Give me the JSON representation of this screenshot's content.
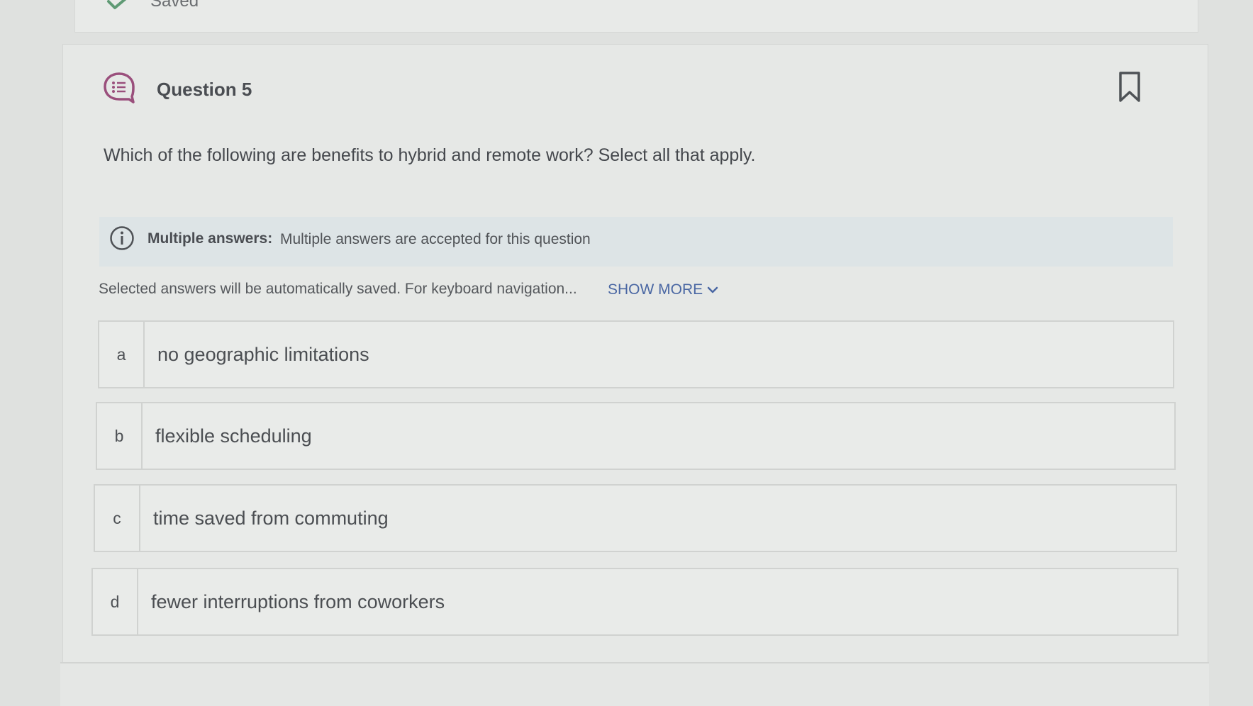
{
  "status": {
    "saved_label": "Saved"
  },
  "question": {
    "title": "Question 5",
    "text": "Which of the following are benefits to hybrid and remote work? Select all that apply."
  },
  "info": {
    "label": "Multiple answers:",
    "text": "Multiple answers are accepted for this question"
  },
  "navigation": {
    "text": "Selected answers will be automatically saved. For keyboard navigation...",
    "show_more_label": "SHOW MORE"
  },
  "options": [
    {
      "letter": "a",
      "text": "no geographic limitations"
    },
    {
      "letter": "b",
      "text": "flexible scheduling"
    },
    {
      "letter": "c",
      "text": "time saved from commuting"
    },
    {
      "letter": "d",
      "text": "fewer interruptions from coworkers"
    }
  ],
  "colors": {
    "accent_link": "#4a67a3",
    "question_icon": "#9a4f7c",
    "saved_check": "#5f9a74"
  },
  "icons": {
    "saved": "checkmark-icon",
    "question": "question-list-icon",
    "bookmark": "bookmark-icon",
    "info": "info-icon",
    "show_more": "chevron-down-icon"
  }
}
